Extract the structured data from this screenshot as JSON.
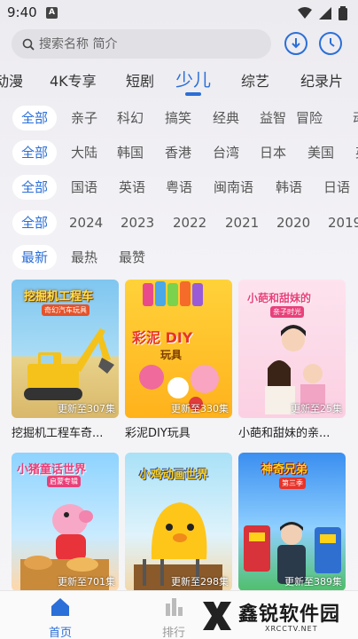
{
  "status": {
    "time": "9:40",
    "a_icon": "A"
  },
  "search": {
    "placeholder": "搜索名称 简介"
  },
  "channels": [
    "动漫",
    "4K专享",
    "短剧",
    "少儿",
    "综艺",
    "纪录片"
  ],
  "active_channel": "少儿",
  "filters": {
    "genre": [
      "全部",
      "亲子",
      "科幻",
      "搞笑",
      "经典",
      "益智",
      "冒险",
      "动"
    ],
    "region": [
      "全部",
      "大陆",
      "韩国",
      "香港",
      "台湾",
      "日本",
      "美国",
      "英"
    ],
    "language": [
      "全部",
      "国语",
      "英语",
      "粤语",
      "闽南语",
      "韩语",
      "日语"
    ],
    "year": [
      "全部",
      "2024",
      "2023",
      "2022",
      "2021",
      "2020",
      "2019"
    ],
    "sort": [
      "最新",
      "最热",
      "最赞"
    ]
  },
  "cards": [
    {
      "title": "挖掘机工程车奇...",
      "badge": "更新至307集",
      "poster_text": "挖掘机工程车",
      "poster_sub": "奇幻汽车玩具"
    },
    {
      "title": "彩泥DIY玩具",
      "badge": "更新至330集",
      "poster_text": "彩泥 DIY",
      "poster_sub": "玩具"
    },
    {
      "title": "小葩和甜妹的亲...",
      "badge": "更新至25集",
      "poster_text": "小葩和甜妹的",
      "poster_sub": "亲子时光"
    },
    {
      "title": "",
      "badge": "更新至701集",
      "poster_text": "小猪童话世界",
      "poster_sub": "启蒙专辑"
    },
    {
      "title": "",
      "badge": "更新至298集",
      "poster_text": "小鸡动画世界",
      "poster_sub": ""
    },
    {
      "title": "",
      "badge": "更新至389集",
      "poster_text": "神奇兄弟",
      "poster_sub": "第三季"
    }
  ],
  "bottom_nav": {
    "home": "首页",
    "rank": "排行"
  },
  "watermark": {
    "brand": "鑫锐软件园",
    "url": "XRCCTV.NET"
  },
  "colors": {
    "accent": "#2b6fd8",
    "background": "#f3f2f6"
  }
}
